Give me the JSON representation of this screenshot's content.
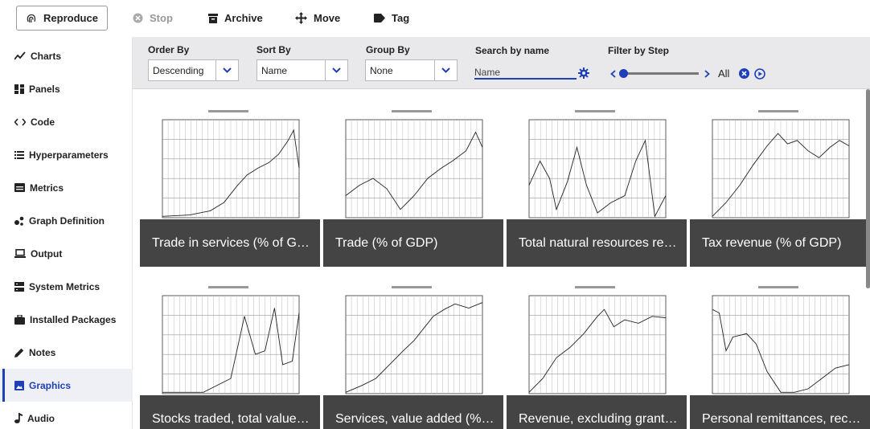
{
  "toolbar": {
    "reproduce": "Reproduce",
    "stop": "Stop",
    "archive": "Archive",
    "move": "Move",
    "tag": "Tag"
  },
  "sidebar": {
    "items": [
      {
        "label": "Charts",
        "icon": "line-chart-icon"
      },
      {
        "label": "Panels",
        "icon": "panels-icon"
      },
      {
        "label": "Code",
        "icon": "code-icon"
      },
      {
        "label": "Hyperparameters",
        "icon": "list-icon"
      },
      {
        "label": "Metrics",
        "icon": "metrics-icon"
      },
      {
        "label": "Graph Definition",
        "icon": "graph-icon"
      },
      {
        "label": "Output",
        "icon": "laptop-icon"
      },
      {
        "label": "System Metrics",
        "icon": "server-icon"
      },
      {
        "label": "Installed Packages",
        "icon": "briefcase-icon"
      },
      {
        "label": "Notes",
        "icon": "pencil-icon"
      },
      {
        "label": "Graphics",
        "icon": "image-icon",
        "active": true
      },
      {
        "label": "Audio",
        "icon": "music-icon"
      }
    ]
  },
  "filters": {
    "order_by": {
      "label": "Order By",
      "value": "Descending"
    },
    "sort_by": {
      "label": "Sort By",
      "value": "Name"
    },
    "group_by": {
      "label": "Group By",
      "value": "None"
    },
    "search": {
      "label": "Search by name",
      "placeholder": "Name"
    },
    "step": {
      "label": "Filter by Step",
      "value": "All"
    }
  },
  "colors": {
    "accent": "#1f3fb8",
    "caption_bg": "#343434",
    "filter_bg": "#e9e9ec"
  },
  "gallery": {
    "cards": [
      {
        "caption": "Trade in services (% of GDP)"
      },
      {
        "caption": "Trade (% of GDP)"
      },
      {
        "caption": "Total natural resources rents (% of GDP)"
      },
      {
        "caption": "Tax revenue (% of GDP)"
      },
      {
        "caption": "Stocks traded, total value (% of GDP)"
      },
      {
        "caption": "Services, value added (% of GDP)"
      },
      {
        "caption": "Revenue, excluding grants (% of GDP)"
      },
      {
        "caption": "Personal remittances, received (% of GDP)"
      }
    ]
  }
}
